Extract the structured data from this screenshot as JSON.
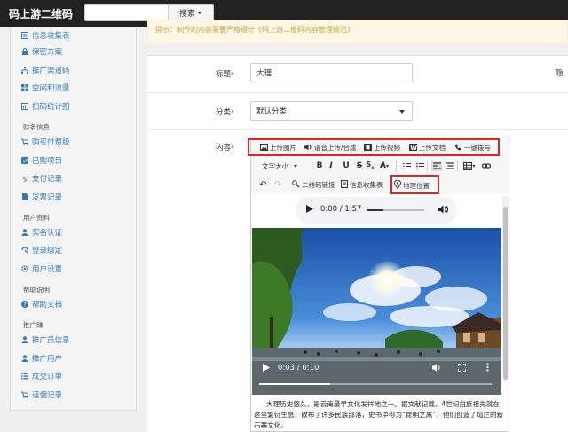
{
  "header": {
    "brand": "码上游二维码",
    "search_value": "",
    "search_button": "搜索"
  },
  "sidebar": {
    "items_top": [
      {
        "label": "信息收集表",
        "icon": "form-icon"
      },
      {
        "label": "保密方案",
        "icon": "lock-icon"
      },
      {
        "label": "推广渠道码",
        "icon": "sitemap-icon"
      },
      {
        "label": "空间和流量",
        "icon": "grid-icon"
      },
      {
        "label": "扫码统计图",
        "icon": "chart-icon"
      }
    ],
    "section_finance": "财务信息",
    "items_finance": [
      {
        "label": "购买付费版",
        "icon": "cart-icon"
      },
      {
        "label": "已购项目",
        "icon": "check-icon"
      },
      {
        "label": "支付记录",
        "icon": "dollar-icon"
      },
      {
        "label": "发票记录",
        "icon": "invoice-icon"
      }
    ],
    "section_user": "用户资料",
    "items_user": [
      {
        "label": "实名认证",
        "icon": "user-icon"
      },
      {
        "label": "登录绑定",
        "icon": "link-icon"
      },
      {
        "label": "用户设置",
        "icon": "gear-icon"
      }
    ],
    "section_help": "帮助说明",
    "items_help": [
      {
        "label": "帮助文档",
        "icon": "help-icon"
      }
    ],
    "section_promo": "推广赚",
    "items_promo": [
      {
        "label": "推广员信息",
        "icon": "person-icon"
      },
      {
        "label": "推广用户",
        "icon": "person-icon"
      },
      {
        "label": "成交订单",
        "icon": "list-icon"
      },
      {
        "label": "返佣记录",
        "icon": "cart-icon"
      }
    ]
  },
  "notice": "提示：制作的内容需要严格遵守《码上游二维码内容管理规范》",
  "form": {
    "title_label": "标题",
    "title_value": "大理",
    "right_label": "隐",
    "category_label": "分类",
    "category_value": "默认分类",
    "content_label": "内容"
  },
  "editor": {
    "toolbar_row1": [
      "上传图片",
      "语音上传/合成",
      "上传视频",
      "上传文档",
      "一键拨号"
    ],
    "font_size_label": "文字大小",
    "toolbar_row3": [
      "二维码链接",
      "信息收集表",
      "地理位置"
    ],
    "audio_time": "0:00 / 1:57",
    "video_time": "0:03 / 0:10",
    "body_text": "大理历史悠久，是云南最早文化发祥地之一。据文献记载，4世纪白族祖先就在这里繁衍生息，散布了许多民族部落，史书中称为“昆明之属”，他们创造了灿烂的新石器文化。"
  },
  "colors": {
    "topbar": "#222222",
    "link": "#337ab7",
    "highlight": "#d9262b",
    "notice_text": "#c8a04a"
  }
}
